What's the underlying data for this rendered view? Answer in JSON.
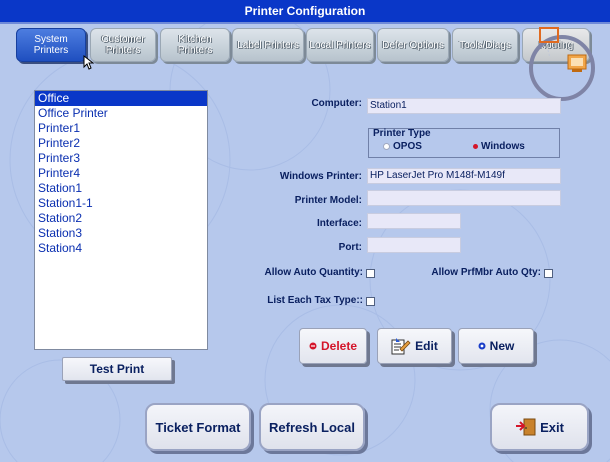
{
  "window": {
    "title": "Printer Configuration"
  },
  "tabs": [
    {
      "label": "System Printers"
    },
    {
      "label": "Customer Printers"
    },
    {
      "label": "Kitchen Printers"
    },
    {
      "label": "Label Printers"
    },
    {
      "label": "Local Printers"
    },
    {
      "label": "Defer Options"
    },
    {
      "label": "Tools/Diags"
    },
    {
      "label": "Routing"
    }
  ],
  "printers": {
    "items": [
      "Office",
      "Office Printer",
      "Printer1",
      "Printer2",
      "Printer3",
      "Printer4",
      "Station1",
      "Station1-1",
      "Station2",
      "Station3",
      "Station4"
    ],
    "selected": "Office"
  },
  "form": {
    "computer_label": "Computer:",
    "computer_value": "Station1",
    "printer_type_label": "Printer Type",
    "opos_label": "OPOS",
    "windows_label": "Windows",
    "selected_type": "Windows",
    "windows_printer_label": "Windows Printer:",
    "windows_printer_value": "HP LaserJet Pro M148f-M149f",
    "printer_model_label": "Printer Model:",
    "printer_model_value": "",
    "interface_label": "Interface:",
    "interface_value": "",
    "port_label": "Port:",
    "port_value": "",
    "allow_auto_qty_label": "Allow Auto Quantity:",
    "allow_prfmbr_label": "Allow PrfMbr Auto Qty:",
    "list_each_tax_label": "List Each Tax Type::"
  },
  "buttons": {
    "delete": "Delete",
    "edit": "Edit",
    "new": "New",
    "test_print": "Test Print",
    "ticket_format": "Ticket Format",
    "refresh_local": "Refresh Local",
    "exit": "Exit"
  },
  "colors": {
    "title_bar": "#0a37c8",
    "background": "#b6c8ec",
    "selection": "#0a37c8",
    "delete_accent": "#d4152a"
  }
}
